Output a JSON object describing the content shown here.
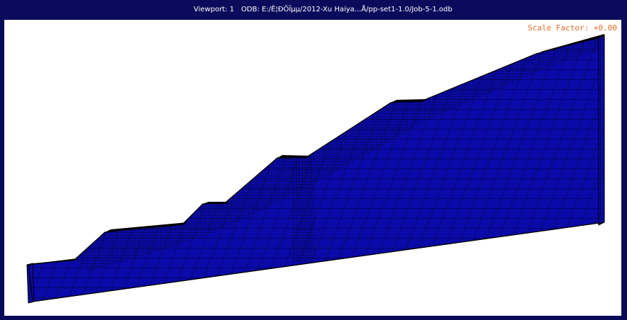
{
  "header": {
    "viewport_label": "Viewport: 1",
    "odb_label": "ODB: E:/Ê¦ÐÖÏµµ/2012-Xu Haiya...Å/pp-set1-1.0/Job-5-1.odb"
  },
  "viewport": {
    "scale_factor": "Scale Factor: +0.00"
  },
  "colors": {
    "frame": "#0b0b5c",
    "canvas": "#ffffff",
    "mesh_fill": "#0a0aa8",
    "mesh_lines": "#000000",
    "scale_text": "#e86a2a"
  }
}
